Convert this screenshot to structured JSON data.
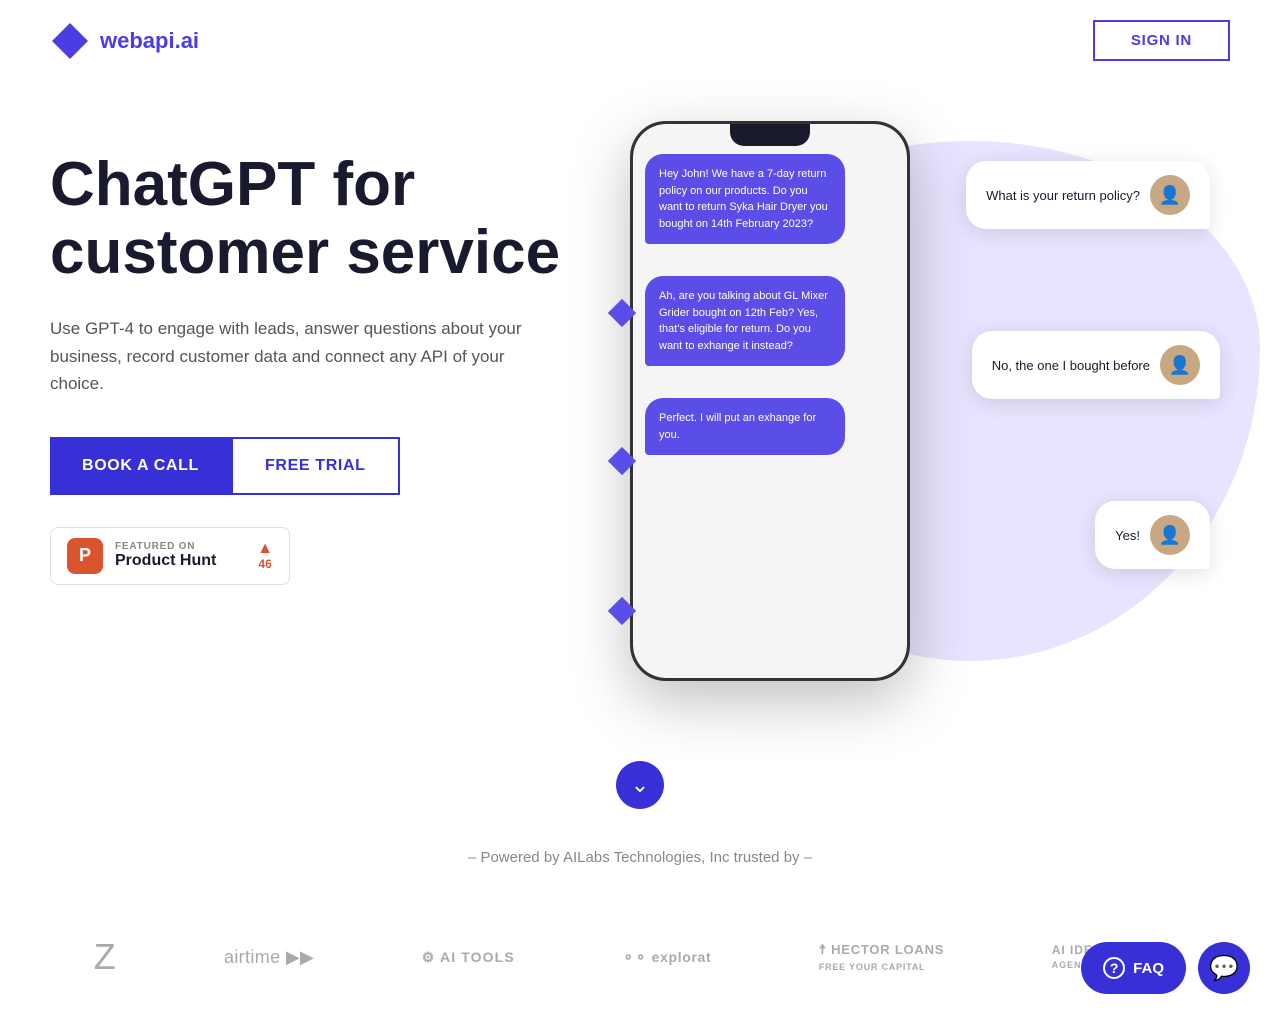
{
  "header": {
    "logo_text_main": "webapi",
    "logo_text_accent": ".ai",
    "sign_in_label": "SIGN IN"
  },
  "hero": {
    "title_line1": "ChatGPT for",
    "title_line2": "customer service",
    "subtitle": "Use GPT-4 to engage with leads, answer questions about your business, record customer data and connect any API of your choice.",
    "btn_book": "BOOK A CALL",
    "btn_trial": "FREE TRIAL"
  },
  "product_hunt": {
    "featured_label": "FEATURED ON",
    "name": "Product Hunt",
    "votes": "46",
    "icon_letter": "P"
  },
  "chat_bubbles": {
    "question1": "What is your return policy?",
    "answer1": "Hey John!\nWe have a 7-day return policy on our products. Do you want to return Syka Hair Dryer you bought on 14th February 2023?",
    "reply1": "No, the one I bought before",
    "answer2": "Ah, are you talking about GL Mixer Grider bought on 12th Feb? Yes, that's eligible for return. Do you want to exhange it instead?",
    "reply2": "Yes!",
    "answer3": "Perfect. I will put an exhange for you."
  },
  "powered_by": {
    "text": "– Powered by AILabs Technologies, Inc trusted by –"
  },
  "partners": [
    {
      "name": "Z",
      "label": "Z"
    },
    {
      "name": "airtime",
      "label": "airtime ▶▶"
    },
    {
      "name": "AI Tools",
      "label": "⚙ AI TOOLS"
    },
    {
      "name": "explorat",
      "label": "⊙⊙ explorat"
    },
    {
      "name": "Hector Loans",
      "label": "🦅 HECTOR LOANS"
    },
    {
      "name": "Idearialab",
      "label": "AI IDEARIALAB"
    }
  ],
  "scroll_btn": {
    "icon": "›"
  },
  "bottom": {
    "faq_label": "FAQ",
    "chat_icon": "💬"
  }
}
